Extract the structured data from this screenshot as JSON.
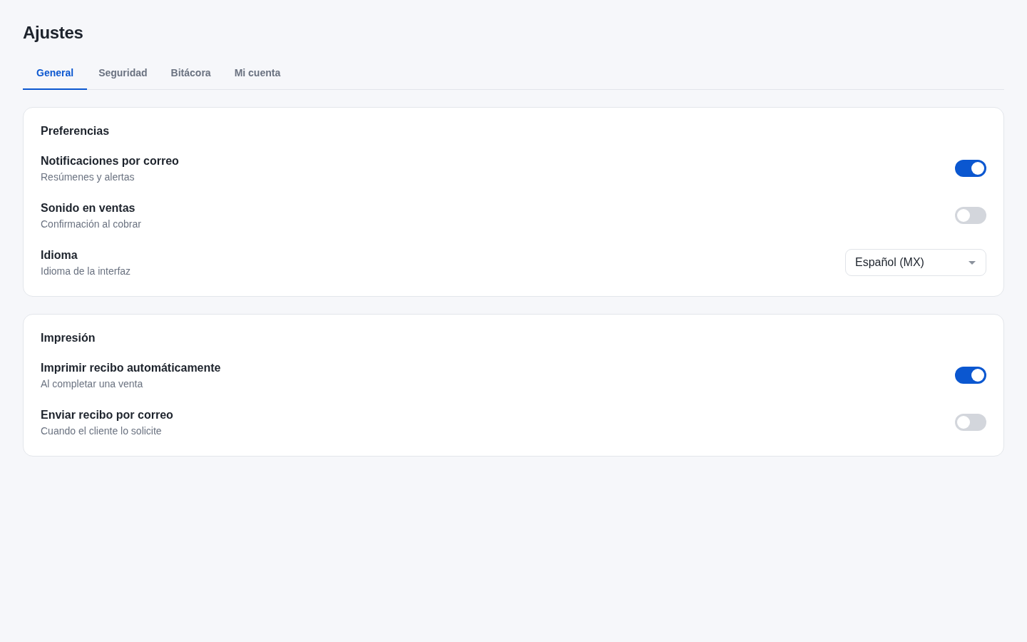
{
  "page": {
    "title": "Ajustes"
  },
  "tabs": [
    {
      "label": "General",
      "selected": true
    },
    {
      "label": "Seguridad",
      "selected": false
    },
    {
      "label": "Bitácora",
      "selected": false
    },
    {
      "label": "Mi cuenta",
      "selected": false
    }
  ],
  "sections": [
    {
      "title": "Preferencias",
      "settings": [
        {
          "kind": "toggle",
          "label": "Notificaciones por correo",
          "description": "Resúmenes y alertas",
          "on": true
        },
        {
          "kind": "toggle",
          "label": "Sonido en ventas",
          "description": "Confirmación al cobrar",
          "on": false
        },
        {
          "kind": "select",
          "label": "Idioma",
          "description": "Idioma de la interfaz",
          "value": "Español (MX)"
        }
      ]
    },
    {
      "title": "Impresión",
      "settings": [
        {
          "kind": "toggle",
          "label": "Imprimir recibo automáticamente",
          "description": "Al completar una venta",
          "on": true
        },
        {
          "kind": "toggle",
          "label": "Enviar recibo por correo",
          "description": "Cuando el cliente lo solicite",
          "on": false
        }
      ]
    }
  ]
}
